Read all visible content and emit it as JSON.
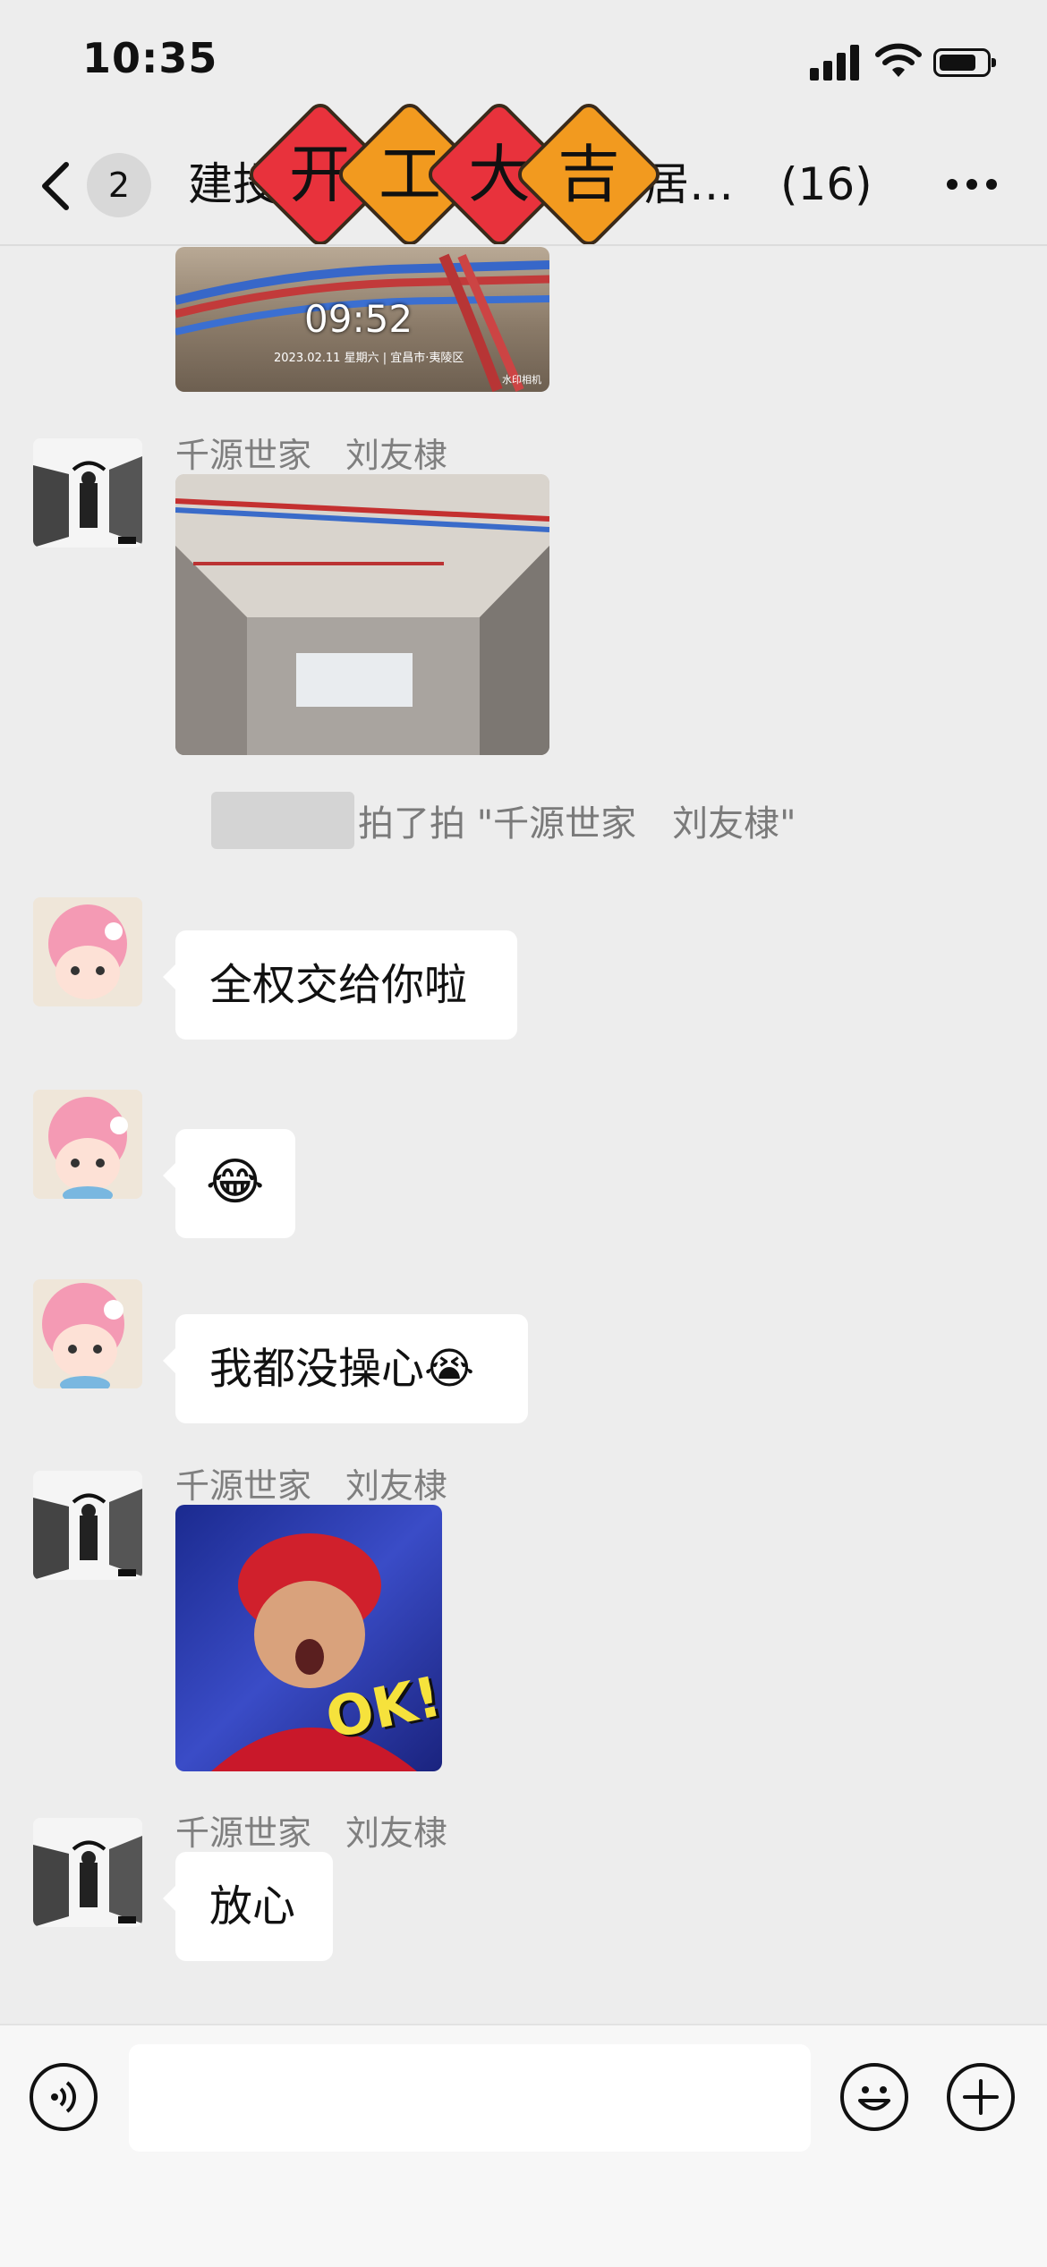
{
  "status_bar": {
    "time": "10:35"
  },
  "nav": {
    "unread_count": "2",
    "title_start": "建投",
    "title_end": "居…",
    "member_count": "(16)",
    "sticker_chars": [
      "开",
      "工",
      "大",
      "吉"
    ],
    "sticker_colors": [
      "#e8323c",
      "#f29a1f",
      "#e8323c",
      "#f29a1f"
    ]
  },
  "photo_top": {
    "time": "09:52",
    "caption": "2023.02.11 星期六 | 宜昌市·夷陵区",
    "watermark": "水印相机"
  },
  "messages": [
    {
      "sender": "千源世家　刘友棣"
    },
    {
      "sender": "千源世家　刘友棣"
    },
    {
      "sender": "千源世家　刘友棣"
    },
    {
      "sender": "千源世家　刘友棣",
      "text": "放心"
    }
  ],
  "pat_notice": "拍了拍 \"千源世家　刘友棣\"",
  "bubbles": {
    "b1": "全权交给你啦",
    "b2": "😂",
    "b3": "我都没操心😭"
  },
  "sticker_ok": "OK!",
  "input": {
    "placeholder": ""
  },
  "colors": {
    "background": "#ededed",
    "bubble": "#ffffff"
  }
}
